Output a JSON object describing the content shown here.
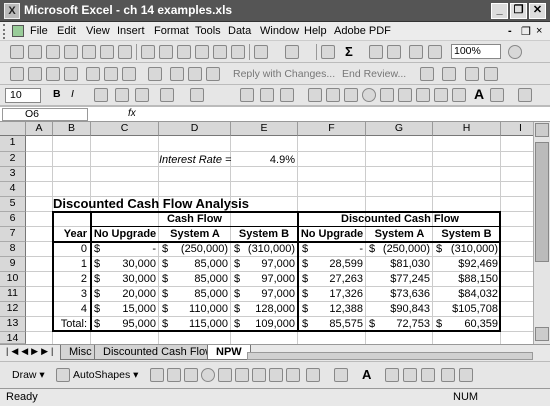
{
  "window": {
    "title": "Microsoft Excel - ch 14 examples.xls",
    "app_icon": "X",
    "minimize": "_",
    "restore": "❐",
    "close": "✕"
  },
  "menu": [
    "File",
    "Edit",
    "View",
    "Insert",
    "Format",
    "Tools",
    "Data",
    "Window",
    "Help",
    "Adobe PDF"
  ],
  "menu_right": {
    "min": "-",
    "restore": "❐",
    "close": "×"
  },
  "toolbar": {
    "zoom": "100%",
    "font_size": "10",
    "reply_label": "Reply with Changes...",
    "end_review_label": "End Review..."
  },
  "formula_bar": {
    "cell_ref": "O6",
    "fx": "fx",
    "formula": ""
  },
  "columns": [
    "A",
    "B",
    "C",
    "D",
    "E",
    "F",
    "G",
    "H",
    "I"
  ],
  "rows": [
    "1",
    "2",
    "3",
    "4",
    "5",
    "6",
    "7",
    "8",
    "9",
    "10",
    "11",
    "12",
    "13",
    "14"
  ],
  "sheet": {
    "interest_label": "Interest Rate =",
    "interest_value": "4.9%",
    "title": "Discounted Cash Flow Analysis",
    "group_cash_flow": "Cash Flow",
    "group_discounted": "Discounted Cash Flow",
    "hdr_year": "Year",
    "hdr_no_upgrade": "No Upgrade",
    "hdr_system_a": "System A",
    "hdr_system_b": "System B",
    "data_rows": [
      {
        "year": "0",
        "c": [
          "$",
          "-"
        ],
        "d": [
          "$",
          "(250,000)"
        ],
        "e": [
          "$",
          "(310,000)"
        ],
        "f": [
          "$",
          "-"
        ],
        "g": [
          "$",
          "(250,000)"
        ],
        "h": [
          "$",
          "(310,000)"
        ]
      },
      {
        "year": "1",
        "c": [
          "$",
          "30,000"
        ],
        "d": [
          "$",
          "85,000"
        ],
        "e": [
          "$",
          "97,000"
        ],
        "f": [
          "$",
          "28,599"
        ],
        "g": [
          "",
          "$81,030"
        ],
        "h": [
          "",
          "$92,469"
        ]
      },
      {
        "year": "2",
        "c": [
          "$",
          "30,000"
        ],
        "d": [
          "$",
          "85,000"
        ],
        "e": [
          "$",
          "97,000"
        ],
        "f": [
          "$",
          "27,263"
        ],
        "g": [
          "",
          "$77,245"
        ],
        "h": [
          "",
          "$88,150"
        ]
      },
      {
        "year": "3",
        "c": [
          "$",
          "20,000"
        ],
        "d": [
          "$",
          "85,000"
        ],
        "e": [
          "$",
          "97,000"
        ],
        "f": [
          "$",
          "17,326"
        ],
        "g": [
          "",
          "$73,636"
        ],
        "h": [
          "",
          "$84,032"
        ]
      },
      {
        "year": "4",
        "c": [
          "$",
          "15,000"
        ],
        "d": [
          "$",
          "110,000"
        ],
        "e": [
          "$",
          "128,000"
        ],
        "f": [
          "$",
          "12,388"
        ],
        "g": [
          "",
          "$90,843"
        ],
        "h": [
          "",
          "$105,708"
        ]
      }
    ],
    "total": {
      "label": "Total:",
      "c": [
        "$",
        "95,000"
      ],
      "d": [
        "$",
        "115,000"
      ],
      "e": [
        "$",
        "109,000"
      ],
      "f": [
        "$",
        "85,575"
      ],
      "g": [
        "$",
        "72,753"
      ],
      "h": [
        "$",
        "60,359"
      ]
    }
  },
  "tabs": [
    "Misc",
    "Discounted Cash Flow",
    "NPW"
  ],
  "active_tab": "NPW",
  "draw_toolbar": {
    "draw": "Draw ▾",
    "autoshapes": "AutoShapes ▾"
  },
  "status": {
    "ready": "Ready",
    "num": "NUM"
  }
}
